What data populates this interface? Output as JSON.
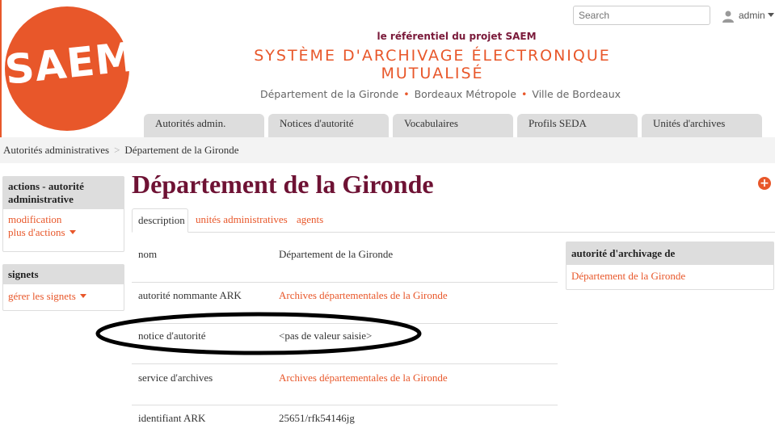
{
  "header": {
    "logo_text": "SAEM",
    "tagline": "le référentiel du projet SAEM",
    "system_title": "SYSTÈME D'ARCHIVAGE ÉLECTRONIQUE MUTUALISÉ",
    "partners": [
      "Département de la Gironde",
      "Bordeaux Métropole",
      "Ville de Bordeaux"
    ],
    "search_placeholder": "Search",
    "user_label": "admin"
  },
  "nav": {
    "tabs": [
      "Autorités admin.",
      "Notices d'autorité",
      "Vocabulaires",
      "Profils SEDA",
      "Unités d'archives"
    ]
  },
  "breadcrumb": {
    "items": [
      "Autorités administratives",
      "Département de la Gironde"
    ],
    "separator": ">"
  },
  "sidebar": {
    "actions_title": "actions - autorité administrative",
    "actions": [
      "modification",
      "plus d'actions"
    ],
    "bookmarks_title": "signets",
    "bookmarks_link": "gérer les signets"
  },
  "main": {
    "title": "Département de la Gironde",
    "tabs": [
      "description",
      "unités administratives",
      "agents"
    ],
    "rows": [
      {
        "label": "nom",
        "value": "Département de la Gironde"
      },
      {
        "label": "autorité nommante ARK",
        "value": "Archives départementales de la Gironde"
      },
      {
        "label": "notice d'autorité",
        "value": "<pas de valeur saisie>"
      },
      {
        "label": "service d'archives",
        "value": "Archives départementales de la Gironde"
      },
      {
        "label": "identifiant ARK",
        "value": "25651/rfk54146jg"
      }
    ]
  },
  "side_panel": {
    "title": "autorité d'archivage de",
    "link": "Département de la Gironde"
  },
  "colors": {
    "accent": "#e8572a",
    "title": "#6e1234",
    "tab_bg": "#dddddd"
  }
}
